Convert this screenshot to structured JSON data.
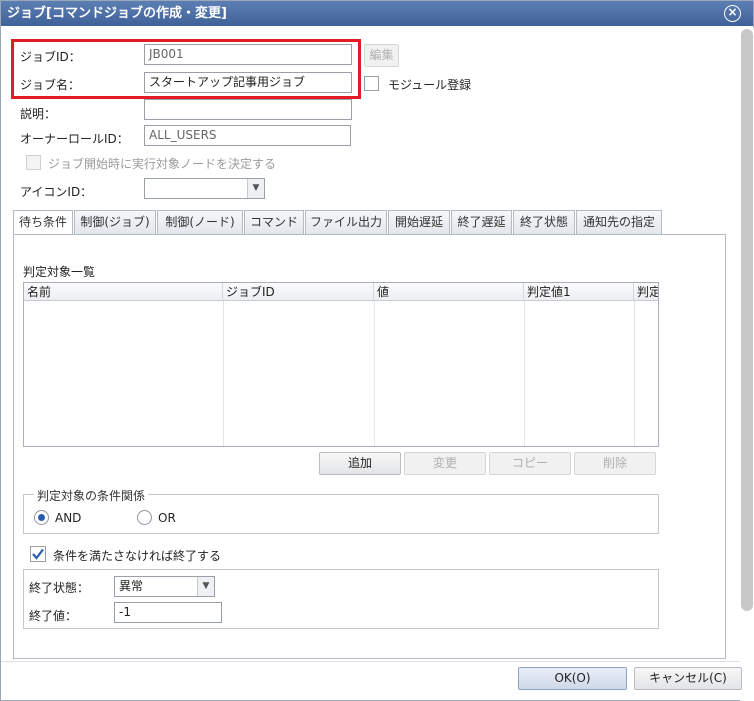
{
  "window": {
    "title": "ジョブ[コマンドジョブの作成・変更]"
  },
  "form": {
    "job_id_label": "ジョブID：",
    "job_id_value": "JB001",
    "edit_button": "編集",
    "job_name_label": "ジョブ名：",
    "job_name_value": "スタートアップ記事用ジョブ",
    "module_label": "モジュール登録",
    "description_label": "説明：",
    "description_value": "",
    "owner_label": "オーナーロールID：",
    "owner_value": "ALL_USERS",
    "decide_node_label": "ジョブ開始時に実行対象ノードを決定する",
    "icon_label": "アイコンID：",
    "icon_value": ""
  },
  "tabs": [
    {
      "label": "待ち条件"
    },
    {
      "label": "制御(ジョブ)"
    },
    {
      "label": "制御(ノード)"
    },
    {
      "label": "コマンド"
    },
    {
      "label": "ファイル出力"
    },
    {
      "label": "開始遅延"
    },
    {
      "label": "終了遅延"
    },
    {
      "label": "終了状態"
    },
    {
      "label": "通知先の指定"
    }
  ],
  "wait": {
    "list_title": "判定対象一覧",
    "columns": [
      "名前",
      "ジョブID",
      "値",
      "判定値1",
      "判定"
    ],
    "add_button": "追加",
    "change_button": "変更",
    "copy_button": "コピー",
    "delete_button": "削除",
    "condition_legend": "判定対象の条件関係",
    "and_label": "AND",
    "or_label": "OR",
    "end_if_label": "条件を満たさなければ終了する",
    "end_status_label": "終了状態：",
    "end_status_value": "異常",
    "end_value_label": "終了値：",
    "end_value_value": "-1"
  },
  "footer": {
    "ok_button": "OK(O)",
    "cancel_button": "キャンセル(C)"
  }
}
